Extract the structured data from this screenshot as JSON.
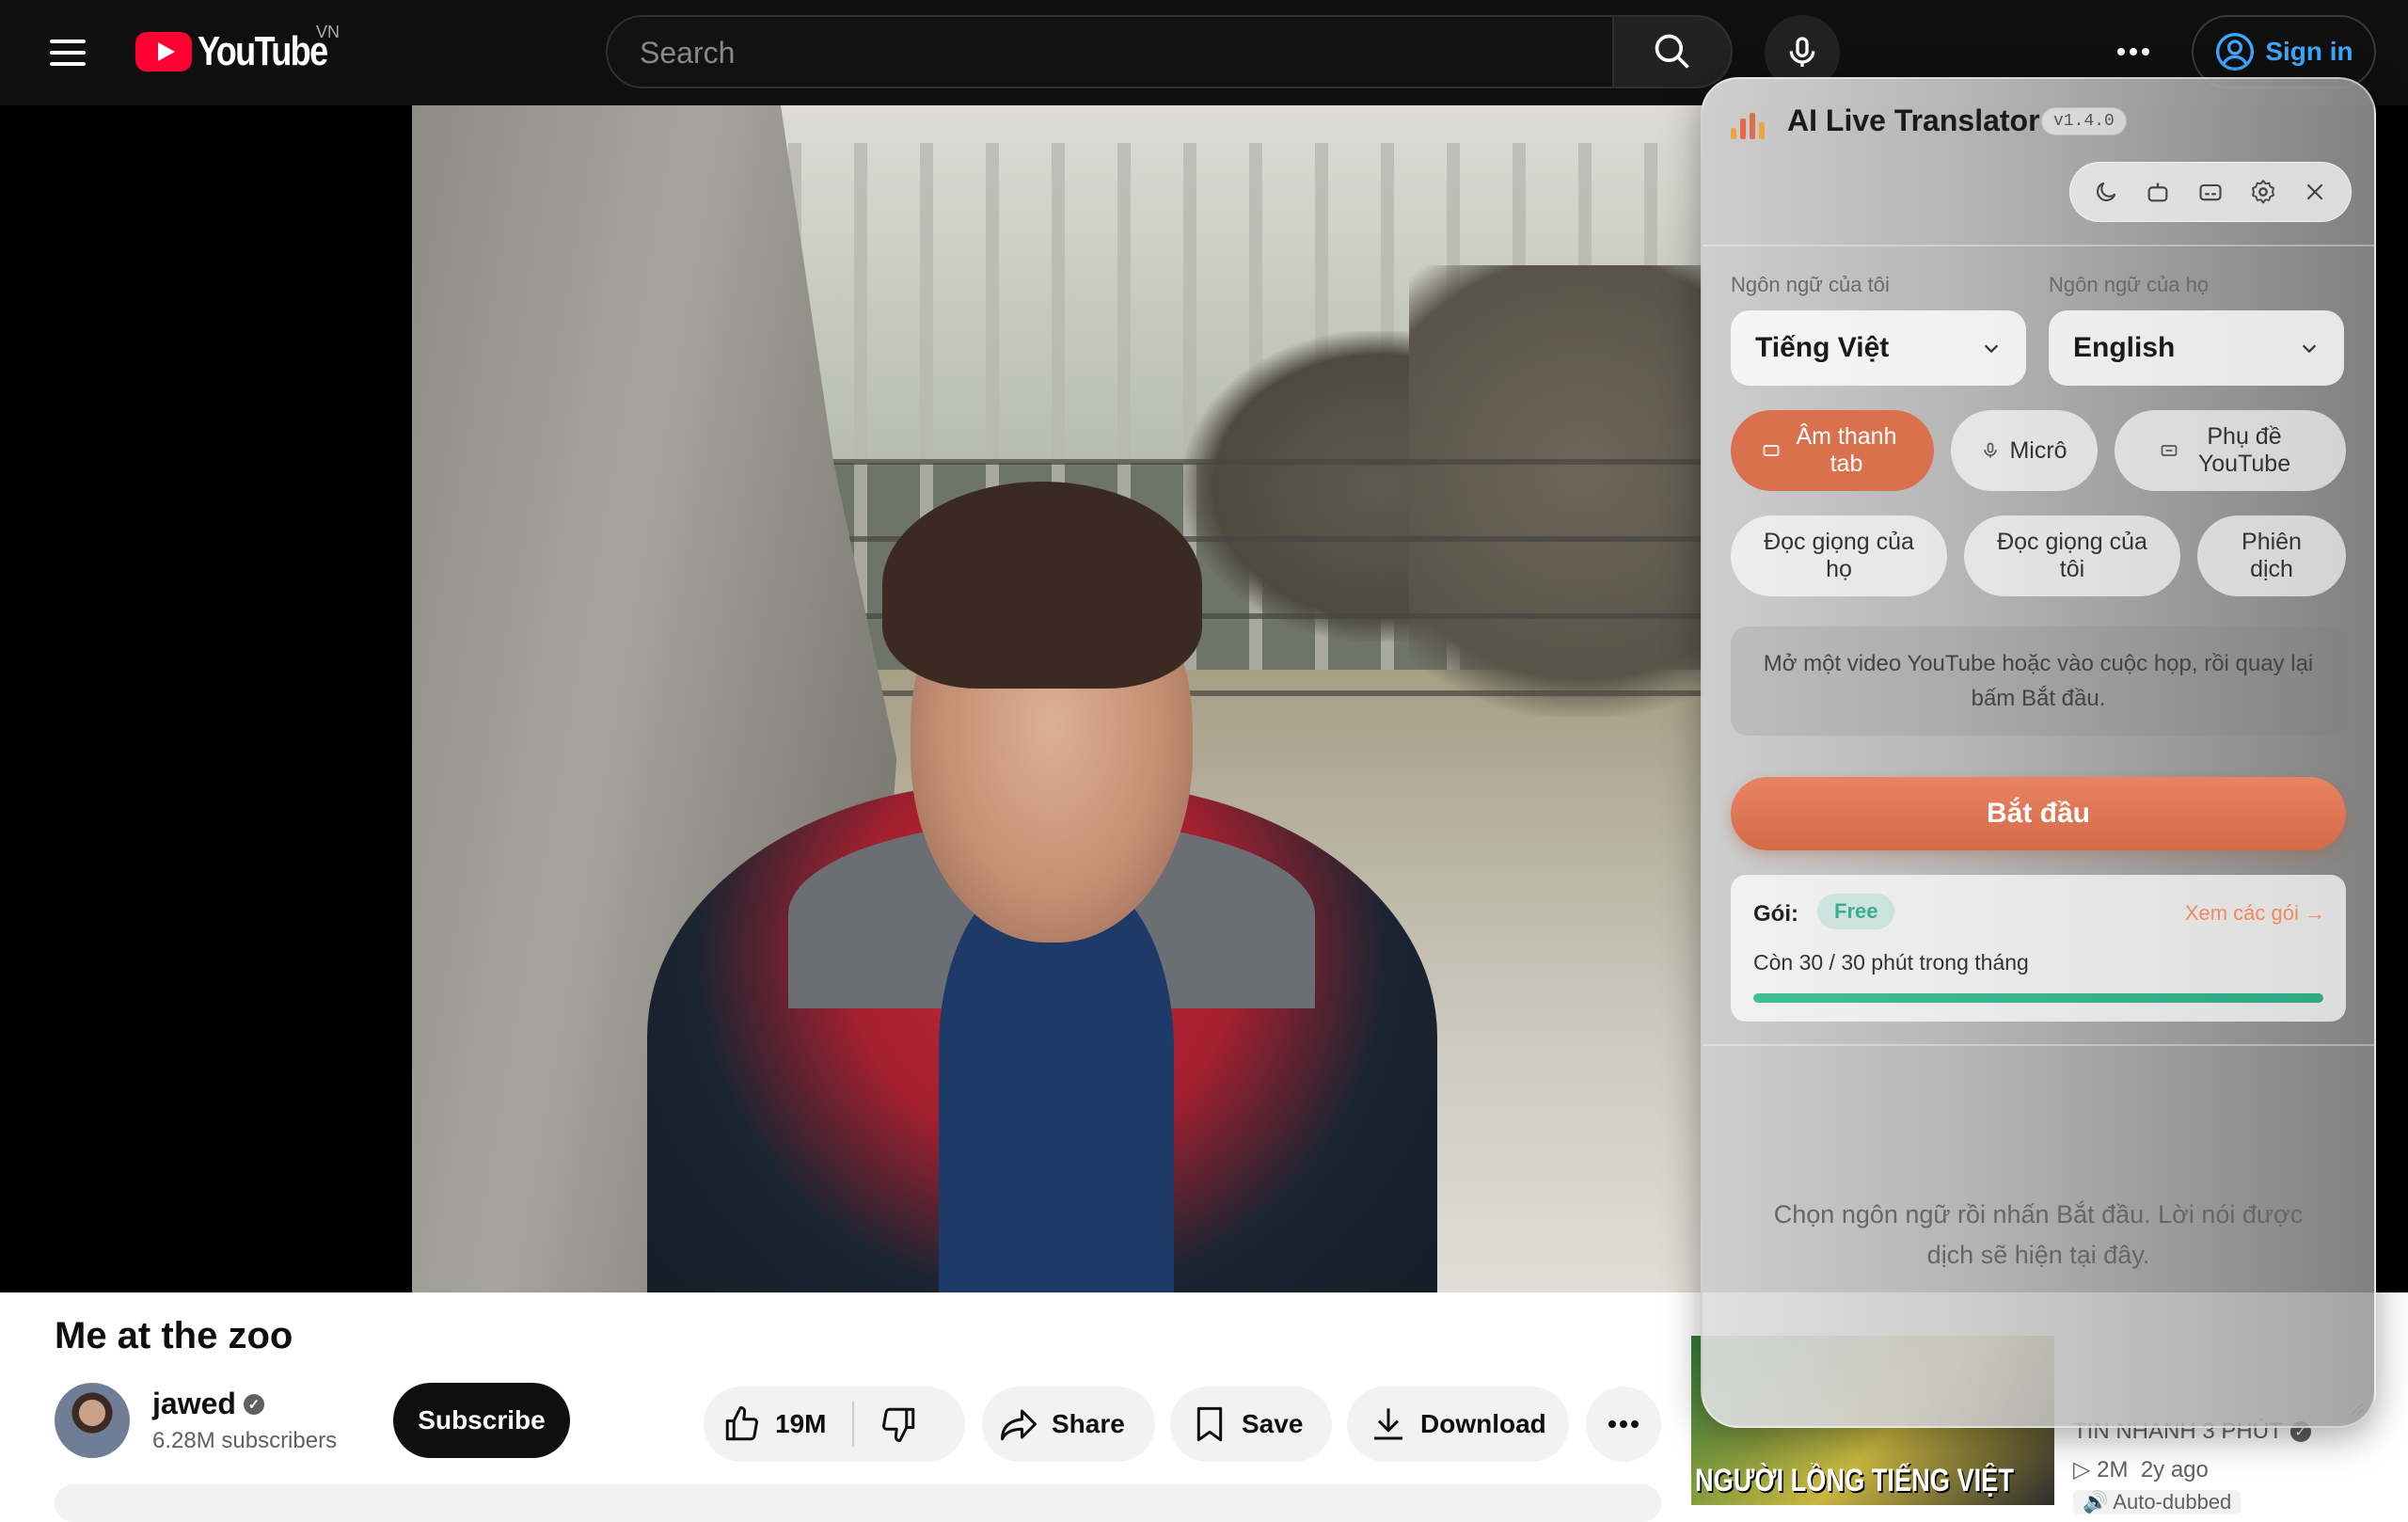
{
  "masthead": {
    "logo_text": "YouTube",
    "country_code": "VN",
    "search_placeholder": "Search",
    "sign_in_label": "Sign in"
  },
  "video": {
    "title": "Me at the zoo",
    "channel_name": "jawed",
    "subscribers": "6.28M subscribers",
    "subscribe_label": "Subscribe",
    "like_count": "19M",
    "share_label": "Share",
    "save_label": "Save",
    "download_label": "Download"
  },
  "recommendation": {
    "thumb_text": "NGƯỜI LỒNG TIẾNG VIỆT",
    "channel": "TIN NHANH 3 PHÚT",
    "views": "2M",
    "age": "2y ago",
    "badge": "Auto-dubbed"
  },
  "extension": {
    "title": "AI Live Translator",
    "version": "v1.4.0",
    "my_language_label": "Ngôn ngữ của tôi",
    "their_language_label": "Ngôn ngữ của họ",
    "my_language_value": "Tiếng Việt",
    "their_language_value": "English",
    "modes": {
      "tab_audio": "Âm thanh tab",
      "mic": "Micrô",
      "youtube_subs": "Phụ đề YouTube",
      "read_theirs": "Đọc giọng của họ",
      "read_mine": "Đọc giọng của tôi",
      "interpret": "Phiên dịch"
    },
    "hint": "Mở một video YouTube hoặc vào cuộc họp, rồi quay lại bấm Bắt đầu.",
    "start_label": "Bắt đầu",
    "plan": {
      "label": "Gói:",
      "tier": "Free",
      "link": "Xem các gói →",
      "usage": "Còn 30 / 30 phút trong tháng",
      "remaining_fraction": 1.0
    },
    "transcript_placeholder": "Chọn ngôn ngữ rồi nhấn Bắt đầu. Lời nói được dịch sẽ hiện tại đây.",
    "accent_color": "#d9714f",
    "plan_color": "#3aaf8e"
  }
}
